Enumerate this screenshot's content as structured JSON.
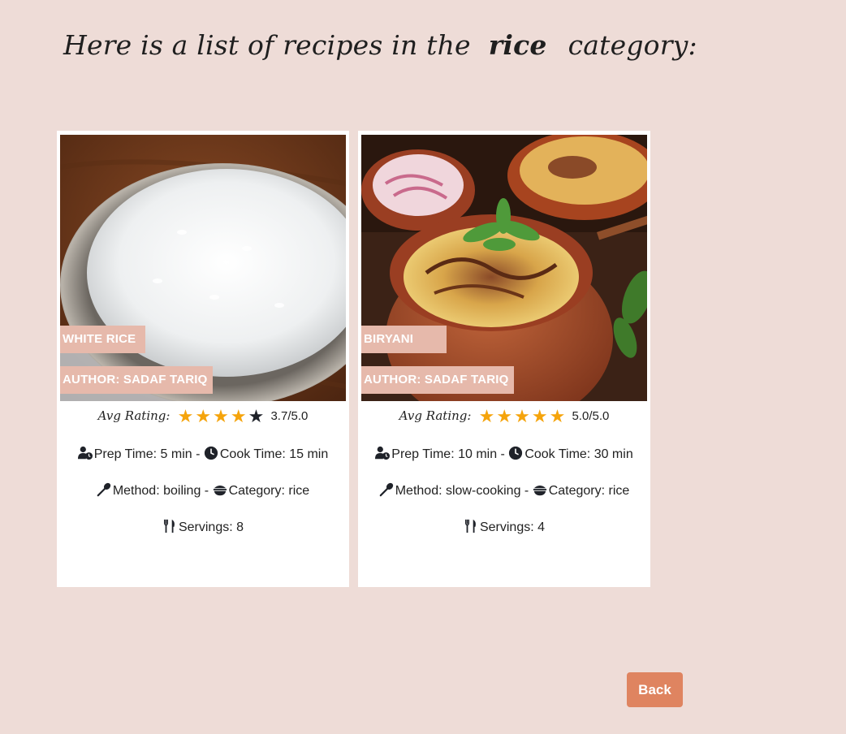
{
  "heading": {
    "prefix": "Here is a list of recipes in the",
    "category": "rice",
    "suffix": "category:"
  },
  "rating_label": "Avg Rating:",
  "recipes": [
    {
      "title": "WHITE RICE",
      "author": "AUTHOR: SADAF TARIQ",
      "rating_value": 3.7,
      "stars_filled": 4,
      "stars_total": 5,
      "rating_text": "3.7/5.0",
      "prep_time": "Prep Time: 5 min",
      "cook_time": "Cook Time: 15 min",
      "method": "Method: boiling",
      "category": "Category: rice",
      "servings": "Servings: 8"
    },
    {
      "title": "BIRYANI",
      "author": "AUTHOR: SADAF TARIQ",
      "rating_value": 5.0,
      "stars_filled": 5,
      "stars_total": 5,
      "rating_text": "5.0/5.0",
      "prep_time": "Prep Time: 10 min",
      "cook_time": "Cook Time: 30 min",
      "method": "Method: slow-cooking",
      "category": "Category: rice",
      "servings": "Servings: 4"
    }
  ],
  "back_button": "Back",
  "colors": {
    "background": "#eedcd7",
    "tag": "#e6b9ab",
    "star_filled": "#f5a40c",
    "star_empty": "#1f2229",
    "back_button": "#df8460"
  },
  "icons": {
    "prep": "user-clock-icon",
    "cook": "clock-icon",
    "method": "spoon-icon",
    "category": "bowl-icon",
    "servings": "utensils-icon"
  }
}
